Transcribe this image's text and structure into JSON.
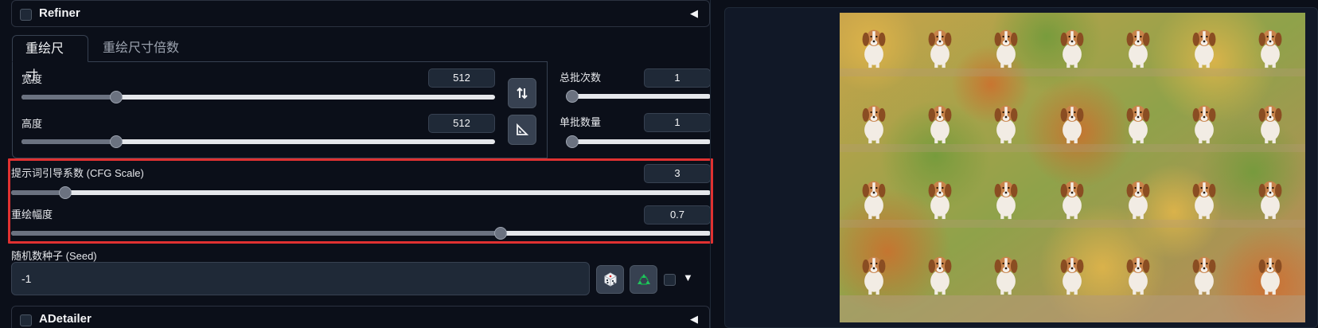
{
  "refiner": {
    "title": "Refiner"
  },
  "tabs": [
    {
      "label": "重绘尺寸"
    },
    {
      "label": "重绘尺寸倍数"
    }
  ],
  "width": {
    "label": "宽度",
    "value": "512",
    "fraction": 0.2
  },
  "height": {
    "label": "高度",
    "value": "512",
    "fraction": 0.2
  },
  "batch_count": {
    "label": "总批次数",
    "value": "1",
    "fraction": 0.0
  },
  "batch_size": {
    "label": "单批数量",
    "value": "1",
    "fraction": 0.0
  },
  "cfg_scale": {
    "label": "提示词引导系数 (CFG Scale)",
    "value": "3",
    "fraction": 0.077
  },
  "denoising": {
    "label": "重绘幅度",
    "value": "0.7",
    "fraction": 0.7
  },
  "seed": {
    "label": "随机数种子 (Seed)",
    "value": "-1"
  },
  "adetailer": {
    "title": "ADetailer"
  },
  "icons": {
    "swap": "swap-dimensions-icon",
    "aspect": "aspect-ratio-icon",
    "dice": "dice-icon",
    "recycle": "recycle-icon"
  },
  "colors": {
    "highlight": "#e03131",
    "background": "#0b0f19",
    "slider_track": "#e5e7eb",
    "slider_thumb": "#6b7280"
  }
}
